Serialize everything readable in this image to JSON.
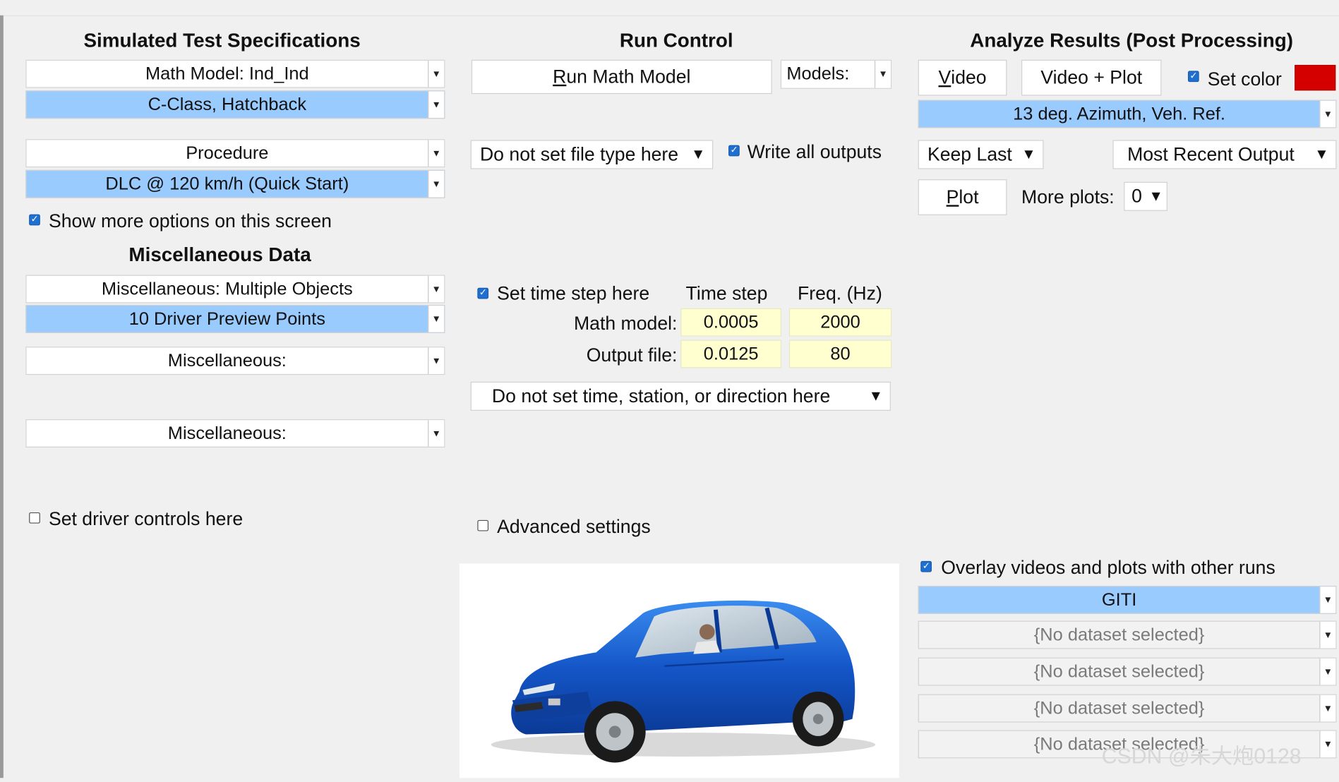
{
  "headings": {
    "simulated": "Simulated Test Specifications",
    "run_control": "Run Control",
    "analyze": "Analyze Results (Post Processing)",
    "misc_data": "Miscellaneous Data"
  },
  "left": {
    "math_model": "Math Model: Ind_Ind",
    "vehicle": "C-Class, Hatchback",
    "procedure": "Procedure",
    "procedure_value": "DLC @ 120 km/h (Quick Start)",
    "show_more": "Show more options on this screen",
    "misc_multiple": "Miscellaneous: Multiple Objects",
    "driver_preview": "10 Driver Preview Points",
    "misc1": "Miscellaneous:",
    "misc2": "Miscellaneous:",
    "driver_controls": "Set driver controls here"
  },
  "middle": {
    "run_button_underline": "R",
    "run_button_rest": "un Math Model",
    "models_label": "Models:",
    "file_type": "Do not set file type here",
    "write_all": "Write all outputs",
    "set_time_step": "Set time step here",
    "time_step_header": "Time step",
    "freq_header": "Freq. (Hz)",
    "math_model_label": "Math model:",
    "output_file_label": "Output file:",
    "math_time_step": "0.0005",
    "math_freq": "2000",
    "output_time_step": "0.0125",
    "output_freq": "80",
    "station_dropdown": "Do not set time, station, or direction here",
    "advanced": "Advanced settings"
  },
  "right": {
    "video_underline": "V",
    "video_rest": "ideo",
    "video_plot": "Video + Plot",
    "set_color": "Set color",
    "set_color_value": "#d40000",
    "camera": "13 deg. Azimuth, Veh. Ref.",
    "keep_last": "Keep Last",
    "most_recent": "Most Recent Output",
    "plot_underline": "P",
    "plot_rest": "lot",
    "more_plots_label": "More plots:",
    "more_plots_value": "0",
    "overlay": "Overlay videos and plots with other runs",
    "dataset_selected": "GITI",
    "dataset_empty_1": "{No dataset selected}",
    "dataset_empty_2": "{No dataset selected}",
    "dataset_empty_3": "{No dataset selected}",
    "dataset_empty_4": "{No dataset selected}"
  },
  "watermark": "CSDN @朱大炮0128"
}
